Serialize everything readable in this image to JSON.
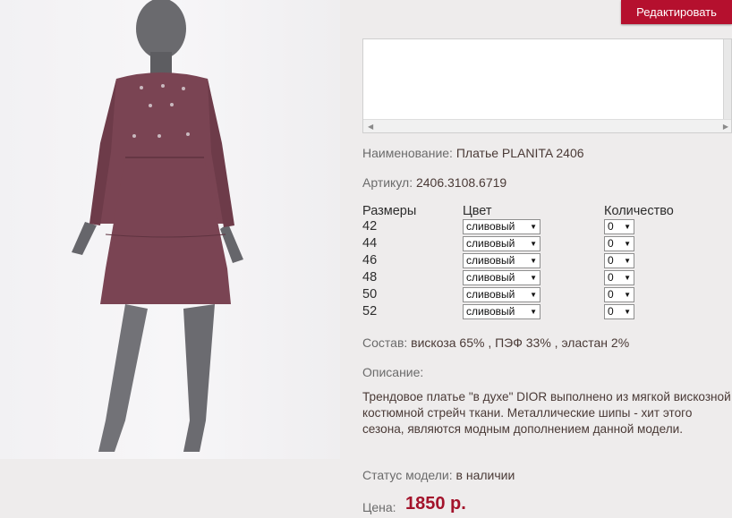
{
  "toolbar": {
    "edit_label": "Редактировать"
  },
  "product": {
    "name_label": "Наименование:",
    "name_value": "Платье PLANITA 2406",
    "sku_label": "Артикул:",
    "sku_value": "2406.3108.6719",
    "composition_label": "Состав:",
    "composition_value": "вискоза 65% , ПЭФ 33% , эластан 2%",
    "description_label": "Описание:",
    "description_text": "Трендовое платье \"в духе\" DIOR выполнено из мягкой вискозной костюмной стрейч ткани. Металлические шипы - хит этого сезона, являются модным дополнением данной модели.",
    "status_label": "Статус модели:",
    "status_value": "в наличии",
    "price_label": "Цена:",
    "price_value": "1850 р."
  },
  "grid": {
    "headers": {
      "sizes": "Размеры",
      "color": "Цвет",
      "quantity": "Количество"
    },
    "rows": [
      {
        "size": "42",
        "color": "сливовый",
        "qty": "0"
      },
      {
        "size": "44",
        "color": "сливовый",
        "qty": "0"
      },
      {
        "size": "46",
        "color": "сливовый",
        "qty": "0"
      },
      {
        "size": "48",
        "color": "сливовый",
        "qty": "0"
      },
      {
        "size": "50",
        "color": "сливовый",
        "qty": "0"
      },
      {
        "size": "52",
        "color": "сливовый",
        "qty": "0"
      }
    ]
  },
  "colors": {
    "accent": "#b5102e",
    "price": "#a3132b",
    "dress": "#7a4453"
  }
}
